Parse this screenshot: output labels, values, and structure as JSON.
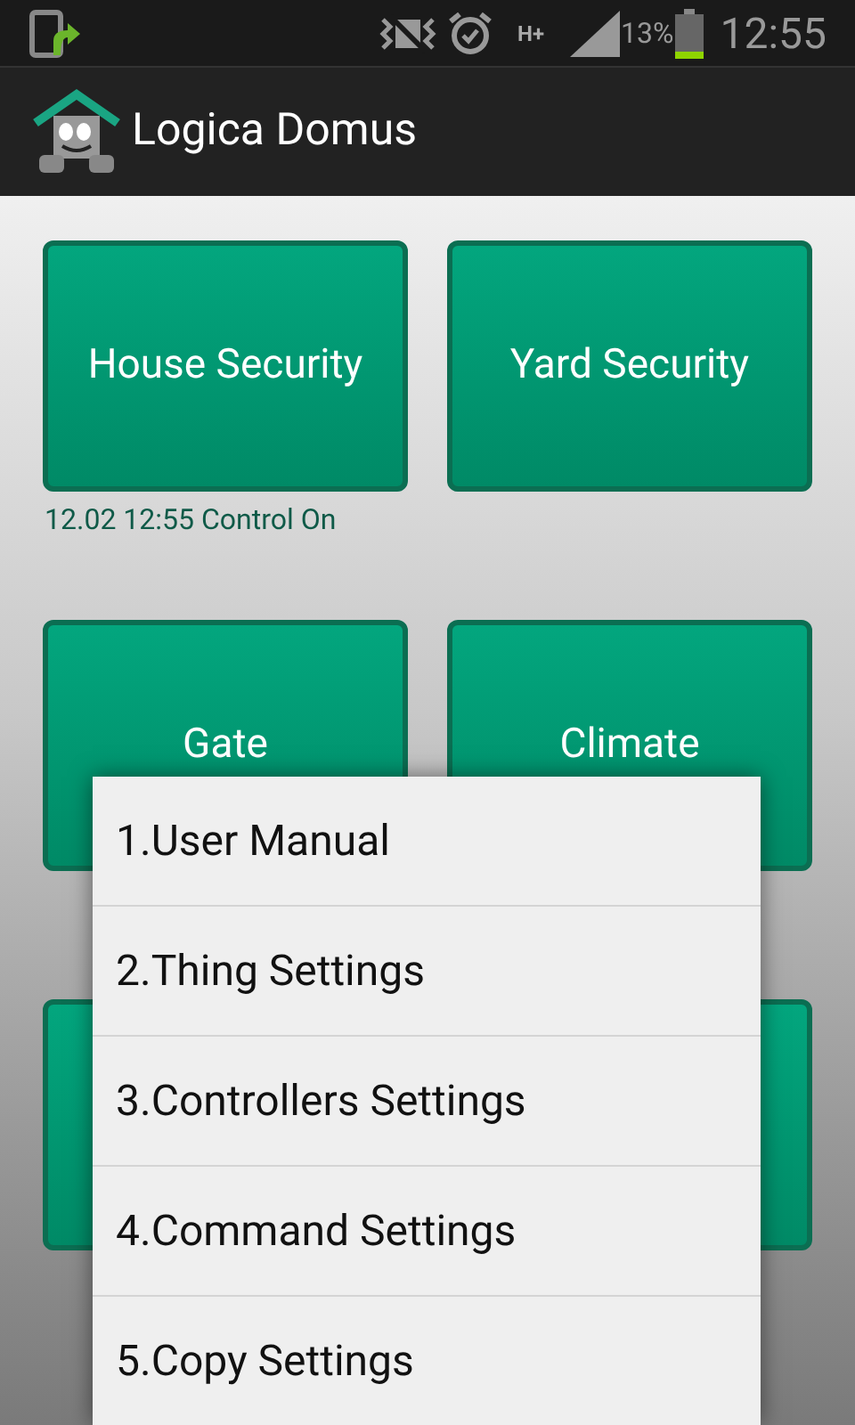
{
  "status_bar": {
    "network": "H+",
    "battery": "13%",
    "time": "12:55"
  },
  "app_bar": {
    "title": "Logica Domus"
  },
  "tiles": [
    {
      "kind": "labeled",
      "label": "House Security",
      "note": "12.02 12:55 Control On"
    },
    {
      "kind": "labeled",
      "label": "Yard Security"
    },
    {
      "kind": "labeled",
      "label": "Gate"
    },
    {
      "kind": "labeled",
      "label": "Climate"
    },
    {
      "kind": "blank"
    },
    {
      "kind": "blank"
    }
  ],
  "menu": {
    "items": [
      "1.User Manual",
      "2.Thing Settings",
      "3.Controllers Settings",
      "4.Command Settings",
      "5.Copy Settings"
    ]
  }
}
